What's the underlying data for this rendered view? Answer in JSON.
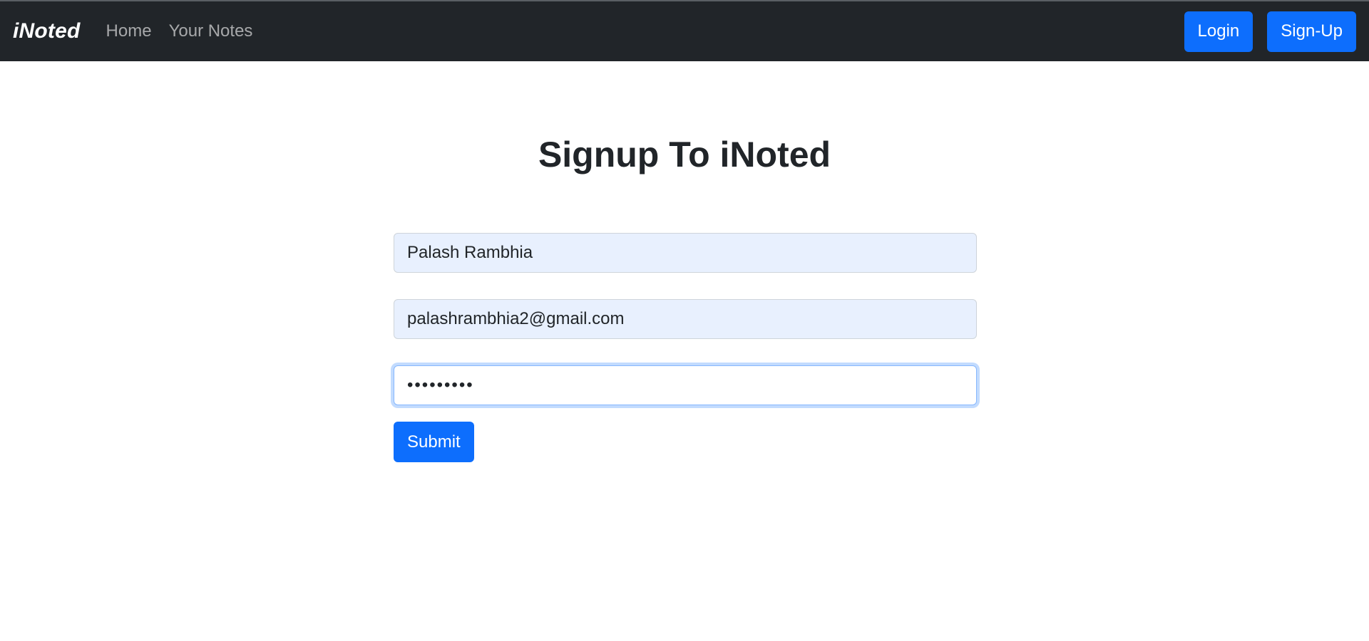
{
  "navbar": {
    "brand": "iNoted",
    "links": [
      {
        "label": "Home"
      },
      {
        "label": "Your Notes"
      }
    ],
    "login_label": "Login",
    "signup_label": "Sign-Up"
  },
  "main": {
    "title": "Signup To iNoted",
    "form": {
      "name_value": "Palash Rambhia",
      "email_value": "palashrambhia2@gmail.com",
      "password_value": "•••••••••",
      "submit_label": "Submit"
    }
  },
  "colors": {
    "navbar_bg": "#212529",
    "primary": "#0d6efd",
    "autofill_bg": "#e8f0fe"
  }
}
